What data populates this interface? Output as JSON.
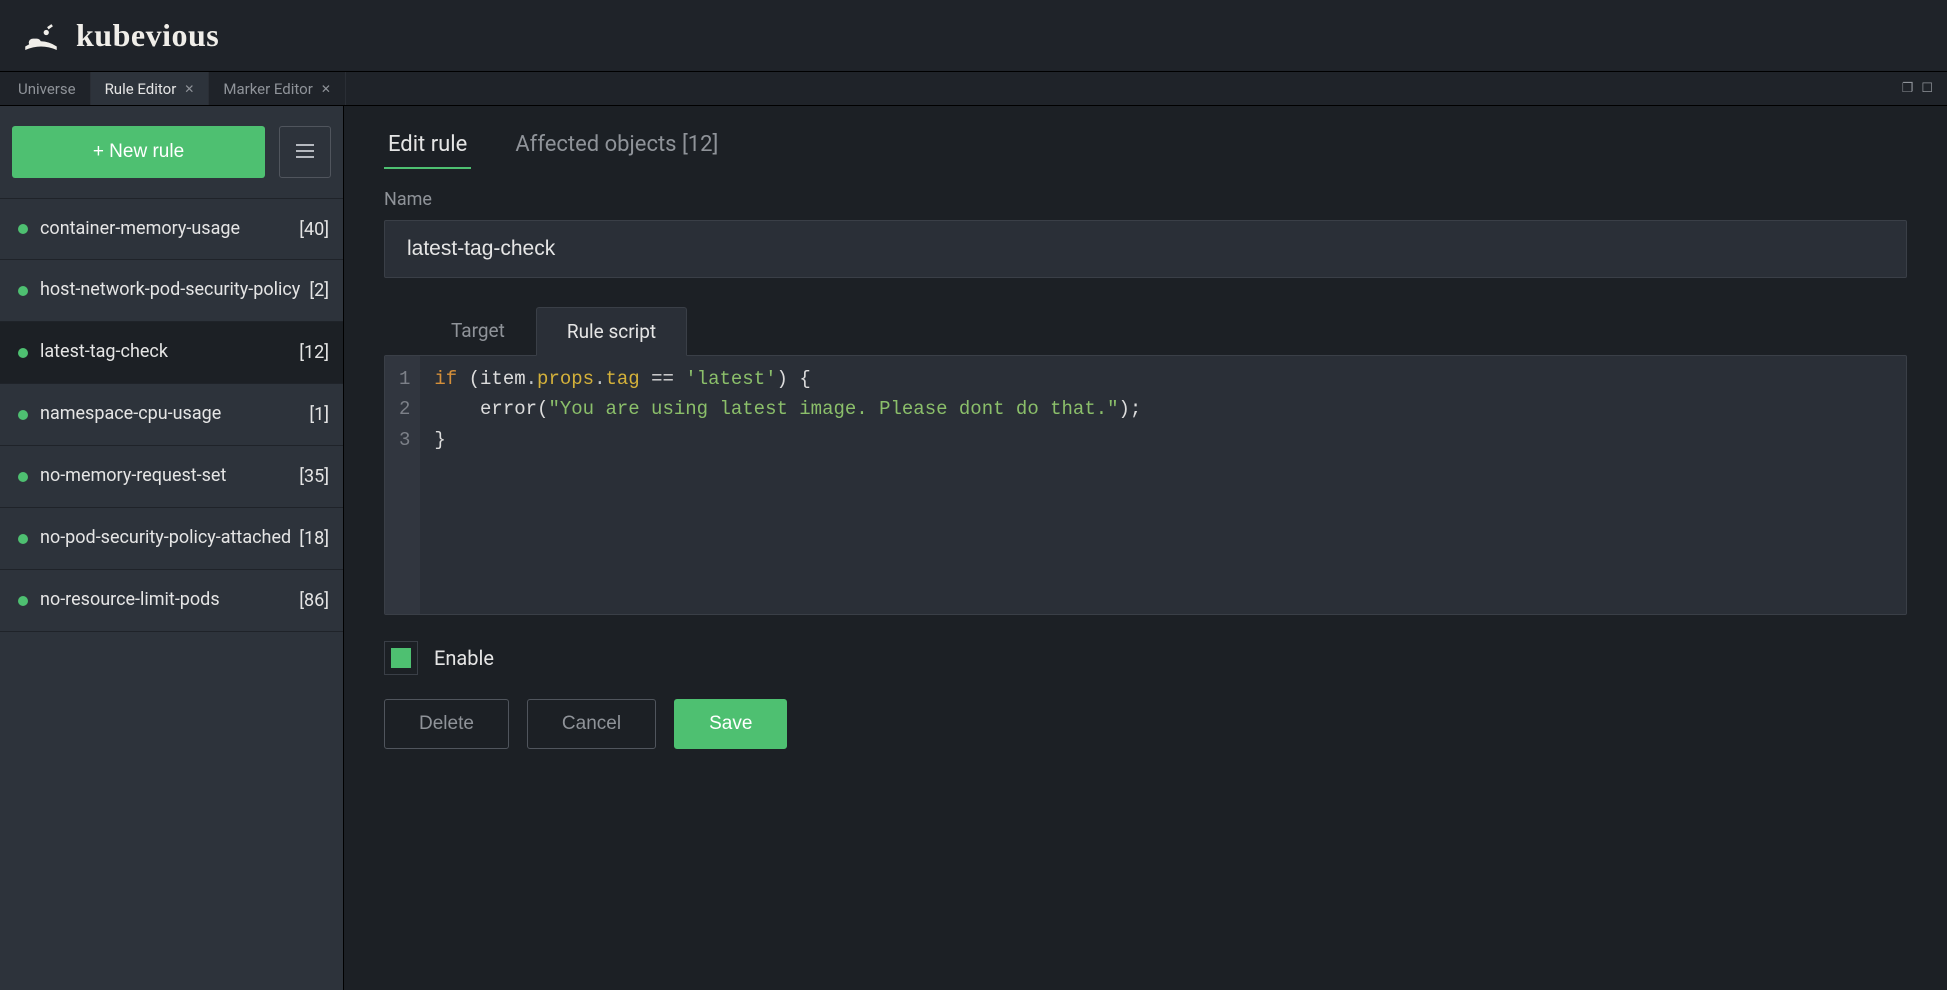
{
  "header": {
    "title": "kubevious"
  },
  "tabs": {
    "items": [
      {
        "label": "Universe",
        "closable": false,
        "active": false
      },
      {
        "label": "Rule Editor",
        "closable": true,
        "active": true
      },
      {
        "label": "Marker Editor",
        "closable": true,
        "active": false
      }
    ]
  },
  "colors": {
    "accent": "#4ec071"
  },
  "sidebar": {
    "new_rule_label": "+ New rule",
    "menu_icon": "hamburger-icon",
    "rules": [
      {
        "name": "container-memory-usage",
        "count": "[40]",
        "selected": false
      },
      {
        "name": "host-network-pod-security-policy",
        "count": "[2]",
        "selected": false
      },
      {
        "name": "latest-tag-check",
        "count": "[12]",
        "selected": true
      },
      {
        "name": "namespace-cpu-usage",
        "count": "[1]",
        "selected": false
      },
      {
        "name": "no-memory-request-set",
        "count": "[35]",
        "selected": false
      },
      {
        "name": "no-pod-security-policy-attached",
        "count": "[18]",
        "selected": false
      },
      {
        "name": "no-resource-limit-pods",
        "count": "[86]",
        "selected": false
      }
    ]
  },
  "main": {
    "tabs": {
      "edit": "Edit rule",
      "affected": "Affected objects [12]"
    },
    "name_label": "Name",
    "name_value": "latest-tag-check",
    "code_tabs": {
      "target": "Target",
      "rule_script": "Rule script"
    },
    "code": {
      "lines": [
        "1",
        "2",
        "3"
      ],
      "line1_if": "if",
      "line1_open": " (item",
      "line1_dot1": ".",
      "line1_props": "props",
      "line1_dot2": ".",
      "line1_tag": "tag",
      "line1_eq": " == ",
      "line1_str": "'latest'",
      "line1_close": ") {",
      "line2_indent": "    error(",
      "line2_str": "\"You are using latest image. Please dont do that.\"",
      "line2_end": ");",
      "line3": "}"
    },
    "enable_label": "Enable",
    "enable_checked": true,
    "buttons": {
      "delete": "Delete",
      "cancel": "Cancel",
      "save": "Save"
    }
  }
}
